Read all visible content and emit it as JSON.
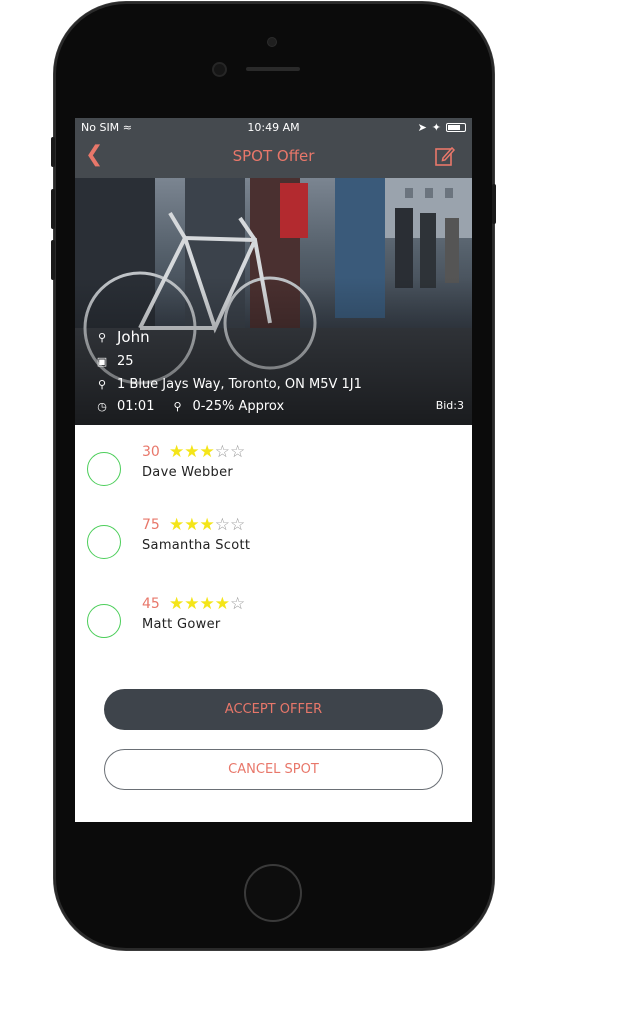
{
  "status_bar": {
    "carrier": "No SIM",
    "time": "10:49 AM"
  },
  "nav": {
    "title": "SPOT Offer"
  },
  "spot": {
    "name": "John",
    "count": "25",
    "address": "1 Blue Jays Way, Toronto, ON M5V 1J1",
    "timer": "01:01",
    "discount": "0-25% Approx",
    "bid": "Bid:3"
  },
  "offers": [
    {
      "amount": "30",
      "rating": 3,
      "max_rating": 5,
      "name": "Dave Webber"
    },
    {
      "amount": "75",
      "rating": 3,
      "max_rating": 5,
      "name": "Samantha Scott"
    },
    {
      "amount": "45",
      "rating": 4,
      "max_rating": 5,
      "name": "Matt Gower"
    }
  ],
  "actions": {
    "accept": "ACCEPT OFFER",
    "cancel": "CANCEL SPOT"
  },
  "colors": {
    "accent": "#e8776a",
    "bar": "#454a4f",
    "star": "#f4e519",
    "radio": "#4cce5a"
  }
}
